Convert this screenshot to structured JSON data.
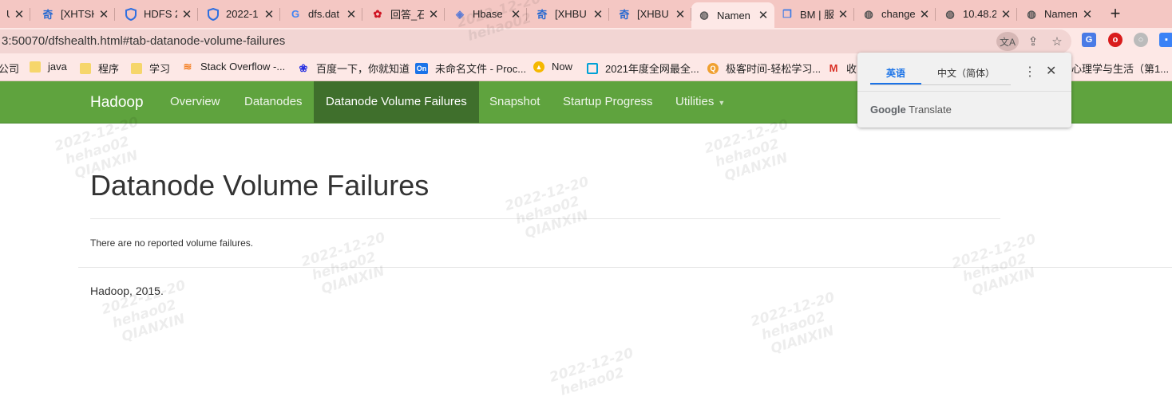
{
  "browser": {
    "tabs": [
      {
        "title": "U",
        "icon": "partial-icon"
      },
      {
        "title": "[XHTSH",
        "icon": "qi-icon"
      },
      {
        "title": "HDFS 2",
        "icon": "shield-icon"
      },
      {
        "title": "2022-1",
        "icon": "shield-icon"
      },
      {
        "title": "dfs.dat",
        "icon": "google-icon"
      },
      {
        "title": "回答_石",
        "icon": "huawei-icon"
      },
      {
        "title": "Hbase",
        "icon": "diamond-icon"
      },
      {
        "title": "[XHBU",
        "icon": "qi-icon"
      },
      {
        "title": "[XHBU",
        "icon": "qi-icon"
      },
      {
        "title": "Namen",
        "icon": "globe-icon"
      },
      {
        "title": "BM | 服",
        "icon": "cube-icon"
      },
      {
        "title": "change",
        "icon": "globe-icon"
      },
      {
        "title": "10.48.2",
        "icon": "globe-icon"
      },
      {
        "title": "Namen",
        "icon": "globe-icon"
      }
    ],
    "close_glyph": "✕",
    "new_tab_glyph": "+",
    "url": "3:50070/dfshealth.html#tab-datanode-volume-failures",
    "bookmarks": [
      {
        "label": "公司",
        "icon": "folder-icon"
      },
      {
        "label": "java",
        "icon": "folder-icon"
      },
      {
        "label": "程序",
        "icon": "folder-icon"
      },
      {
        "label": "学习",
        "icon": "folder-icon"
      },
      {
        "label": "Stack Overflow -...",
        "icon": "stackoverflow-icon"
      },
      {
        "label": "百度一下，你就知道",
        "icon": "baidu-icon"
      },
      {
        "label": "未命名文件 - Proc...",
        "icon": "processon-icon"
      },
      {
        "label": "Now",
        "icon": "now-icon"
      },
      {
        "label": "2021年度全网最全...",
        "icon": "bilibili-icon"
      },
      {
        "label": "极客时间-轻松学习...",
        "icon": "geektime-icon"
      },
      {
        "label": "收",
        "icon": "gmail-icon"
      },
      {
        "label": "心理学与生活（第1...",
        "icon": "book-icon"
      }
    ]
  },
  "translate_popup": {
    "source_lang": "英语",
    "target_lang": "中文（简体）",
    "brand_google": "Google",
    "brand_translate": "Translate",
    "menu_glyph": "⋮",
    "close_glyph": "✕"
  },
  "navbar": {
    "brand": "Hadoop",
    "items": [
      "Overview",
      "Datanodes",
      "Datanode Volume Failures",
      "Snapshot",
      "Startup Progress",
      "Utilities"
    ],
    "active_index": 2,
    "colors": {
      "bar": "#5fa33e",
      "active": "#3f6f2c"
    }
  },
  "page": {
    "title": "Datanode Volume Failures",
    "message": "There are no reported volume failures.",
    "footer": "Hadoop, 2015."
  },
  "watermark": {
    "date": "2022-12-20",
    "user": "hehao02",
    "org": "QIANXIN"
  }
}
